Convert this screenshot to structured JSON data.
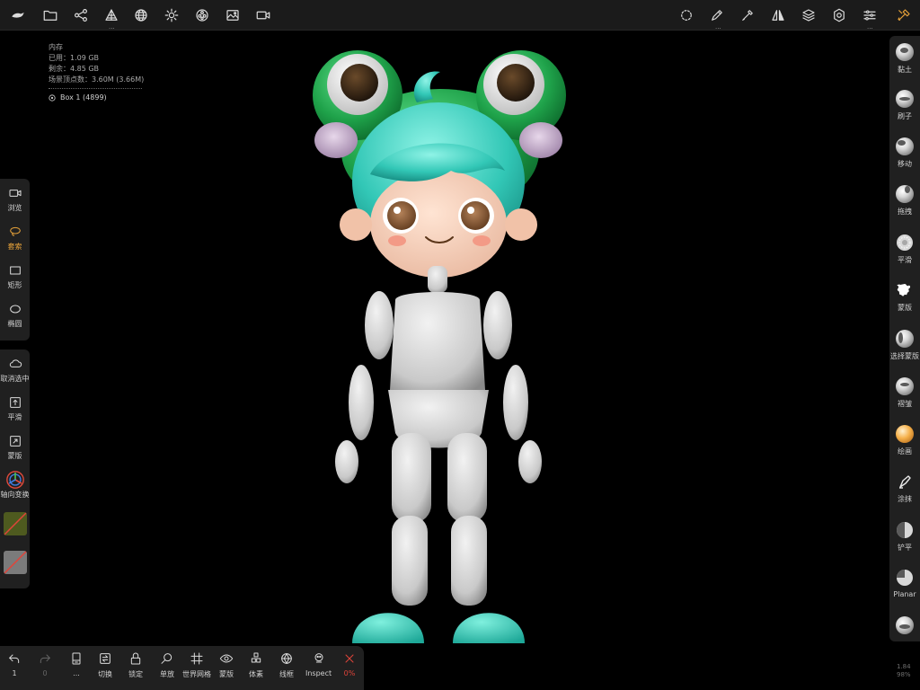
{
  "colors": {
    "accent": "#e8a33a",
    "panel": "#202020",
    "topbar": "#1b1b1b",
    "cancel": "#e0443a"
  },
  "topbar": {
    "left_icons": [
      "logo-icon",
      "folder-icon",
      "scene-graph-icon",
      "topology-icon",
      "sphere-grid-icon",
      "sun-icon",
      "material-icon",
      "image-icon",
      "camera-icon"
    ],
    "right_icons": [
      "selection-circle-icon",
      "pen-icon",
      "eyedropper-icon",
      "symmetry-icon",
      "layers-icon",
      "settings-icon",
      "sliders-icon",
      "tools-icon"
    ],
    "dots": "..."
  },
  "info": {
    "title": "内存",
    "used": "已用：1.09 GB",
    "remaining": "剩余：4.85 GB",
    "vertices": "场景顶点数：3.60M (3.66M)",
    "mesh": "Box 1 (4899)"
  },
  "left_tools": [
    {
      "label": "浏览",
      "icon": "camera-icon"
    },
    {
      "label": "套索",
      "icon": "lasso-icon",
      "active": true
    },
    {
      "label": "矩形",
      "icon": "rectangle-icon"
    },
    {
      "label": "椭圆",
      "icon": "ellipse-icon"
    }
  ],
  "left_actions": [
    {
      "label": "取消选中",
      "icon": "cloud-icon"
    },
    {
      "label": "平滑",
      "icon": "smooth-icon"
    },
    {
      "label": "蒙版",
      "icon": "mask-icon"
    },
    {
      "label": "轴向变换",
      "icon": "gizmo-icon"
    }
  ],
  "right_tools": [
    "黏土",
    "刷子",
    "移动",
    "拖拽",
    "平滑",
    "蒙版",
    "选择蒙版",
    "褶皱",
    "绘画",
    "涂抹",
    "铲平",
    "Planar"
  ],
  "bottom_tools": [
    {
      "label": "1",
      "icon": "undo-icon"
    },
    {
      "label": "0",
      "icon": "redo-icon"
    },
    {
      "label": "...",
      "icon": "history-icon"
    },
    {
      "label": "切换",
      "icon": "toggle-icon"
    },
    {
      "label": "锁定",
      "icon": "lock-icon"
    },
    {
      "label": "单放",
      "icon": "isolate-icon"
    },
    {
      "label": "世界网格",
      "icon": "grid-icon"
    },
    {
      "label": "蒙版",
      "icon": "eye-icon"
    },
    {
      "label": "体素",
      "icon": "voxel-icon"
    },
    {
      "label": "线框",
      "icon": "wireframe-icon"
    },
    {
      "label": "Inspect",
      "icon": "inspect-icon"
    },
    {
      "label": "0%",
      "icon": "close-icon"
    }
  ],
  "stats": {
    "fps": "1.84",
    "percent": "98%"
  }
}
